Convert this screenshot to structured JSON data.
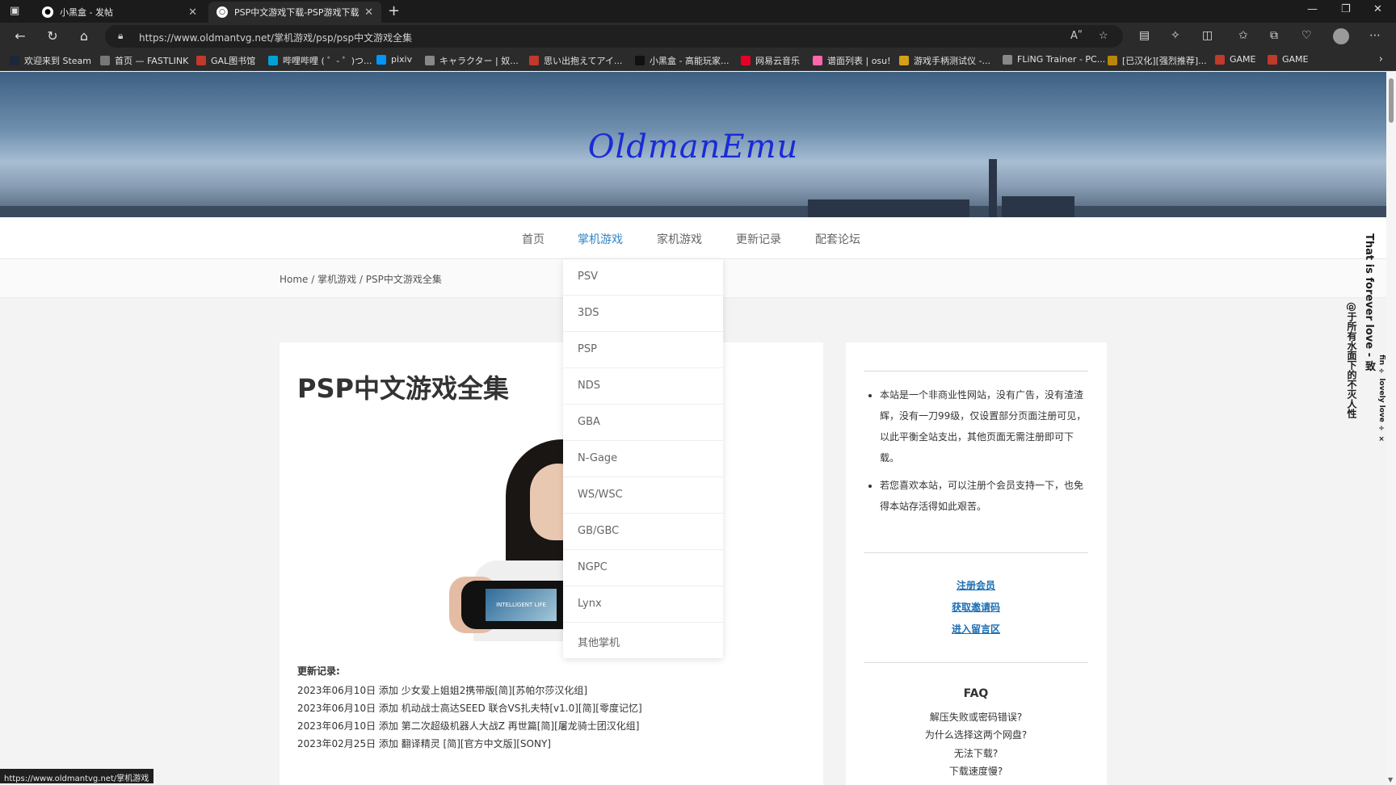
{
  "tabs": [
    {
      "title": "小黑盒 - 发帖"
    },
    {
      "title": "PSP中文游戏下载-PSP游戏下载"
    }
  ],
  "browser": {
    "url": "https://www.oldmantvg.net/掌机游戏/psp/psp中文游戏全集",
    "reader_label": "Aʺ"
  },
  "bookmarks": [
    {
      "label": "欢迎来到 Steam",
      "color": "#1b2838"
    },
    {
      "label": "首页 — FASTLINK",
      "color": "#777777"
    },
    {
      "label": "GAL图书馆",
      "color": "#c0392b"
    },
    {
      "label": "哔哩哔哩 ( ゜- ゜)つ...",
      "color": "#00a1d6"
    },
    {
      "label": "pixiv",
      "color": "#0096fa"
    },
    {
      "label": "キャラクター | 奴...",
      "color": "#888888"
    },
    {
      "label": "思い出抱えてアイ...",
      "color": "#c0392b"
    },
    {
      "label": "小黑盒 - 高能玩家...",
      "color": "#111111"
    },
    {
      "label": "网易云音乐",
      "color": "#e60026"
    },
    {
      "label": "谱面列表 | osu!",
      "color": "#ff66aa"
    },
    {
      "label": "游戏手柄测试仪 -...",
      "color": "#d4a017"
    },
    {
      "label": "FLiNG Trainer - PC...",
      "color": "#888888"
    },
    {
      "label": "[已汉化][强烈推荐]...",
      "color": "#b8860b"
    },
    {
      "label": "GAME",
      "color": "#c0392b"
    },
    {
      "label": "GAME",
      "color": "#c0392b"
    }
  ],
  "site": {
    "logo": "OldmanEmu",
    "nav": [
      "首页",
      "掌机游戏",
      "家机游戏",
      "更新记录",
      "配套论坛"
    ],
    "breadcrumb": "Home / 掌机游戏 / PSP中文游戏全集"
  },
  "dropdown": [
    "PSV",
    "3DS",
    "PSP",
    "NDS",
    "GBA",
    "N-Gage",
    "WS/WSC",
    "GB/GBC",
    "NGPC",
    "Lynx",
    "其他掌机"
  ],
  "article": {
    "title": "PSP中文游戏全集",
    "photo_screen_text": "INTELLIGENT LIFE",
    "updates_label": "更新记录:",
    "updates": [
      "2023年06月10日 添加 少女爱上姐姐2携带版[简][苏帕尔莎汉化组]",
      "2023年06月10日 添加 机动战士高达SEED 联合VS扎夫特[v1.0][简][零度记忆]",
      "2023年06月10日 添加 第二次超级机器人大战Z 再世篇[简][屠龙骑士团汉化组]",
      "2023年02月25日 添加 翻译精灵 [简][官方中文版][SONY]"
    ]
  },
  "sidebar": {
    "notice": [
      "本站是一个非商业性网站，没有广告，没有渣渣辉，没有一刀99级，仅设置部分页面注册可见，以此平衡全站支出，其他页面无需注册即可下载。",
      "若您喜欢本站，可以注册个会员支持一下，也免得本站存活得如此艰苦。"
    ],
    "links": [
      "注册会员",
      "获取邀请码",
      "进入留言区"
    ],
    "faq_title": "FAQ",
    "faq": [
      "解压失败或密码错误?",
      "为什么选择这两个网盘?",
      "无法下载?",
      "下载速度慢?"
    ]
  },
  "overlay_text": {
    "line1": "That is forever love - 致",
    "line2": "@于所有水面下的不灭人性",
    "line3": "fin ÷ lovely love ÷ ×"
  },
  "status_url": "https://www.oldmantvg.net/掌机游戏"
}
